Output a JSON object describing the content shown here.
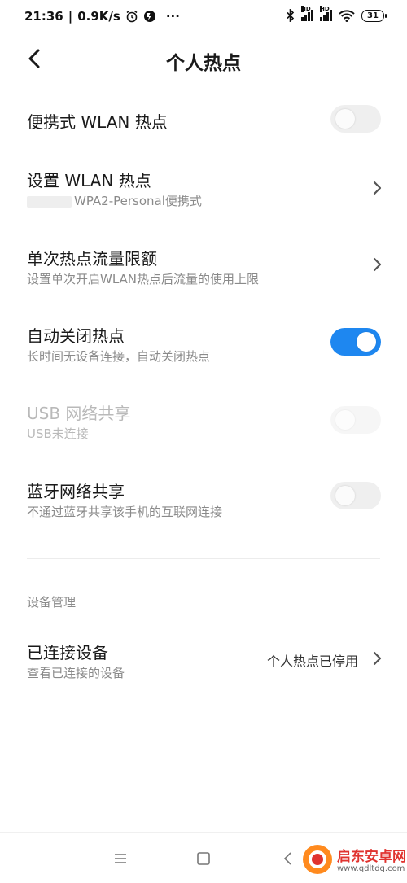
{
  "status_bar": {
    "time": "21:36",
    "net_speed": "0.9K/s",
    "more": "···",
    "battery": "31",
    "signal_hd_1": "HD",
    "signal_hd_2": "HD"
  },
  "header": {
    "title": "个人热点"
  },
  "settings": {
    "portable_hotspot": {
      "label": "便携式 WLAN 热点",
      "enabled": false
    },
    "setup_hotspot": {
      "label": "设置 WLAN 热点",
      "subtitle": "WPA2-Personal便携式"
    },
    "data_limit": {
      "label": "单次热点流量限额",
      "subtitle": "设置单次开启WLAN热点后流量的使用上限"
    },
    "auto_close": {
      "label": "自动关闭热点",
      "subtitle": "长时间无设备连接，自动关闭热点",
      "enabled": true
    },
    "usb_tether": {
      "label": "USB 网络共享",
      "subtitle": "USB未连接",
      "enabled": false,
      "disabled": true
    },
    "bt_tether": {
      "label": "蓝牙网络共享",
      "subtitle": "不通过蓝牙共享该手机的互联网连接",
      "enabled": false
    }
  },
  "device_section": {
    "header": "设备管理",
    "connected": {
      "label": "已连接设备",
      "subtitle": "查看已连接的设备",
      "value": "个人热点已停用"
    }
  },
  "watermark": {
    "text": "启东安卓网",
    "url": "www.qdltdq.com"
  },
  "colors": {
    "accent": "#1e87f0",
    "toggle_off": "#efefef",
    "secondary_text": "#8a8a8a"
  }
}
